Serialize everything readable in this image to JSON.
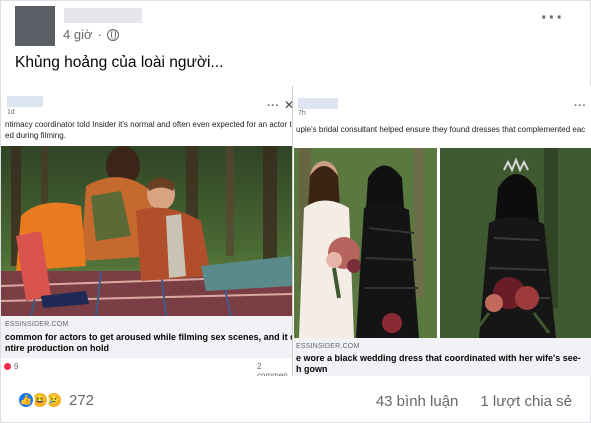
{
  "post": {
    "time": "4 giờ",
    "caption": "Khủng hoảng của loài người..."
  },
  "left_shot": {
    "time": "1d",
    "snippet_lines": [
      "ntimacy coordinator told Insider it's normal and often even expected for an actor to get",
      "ed during filming."
    ],
    "domain": "ESSINSIDER.COM",
    "headline_lines": [
      "common for actors to get aroused while filming sex scenes, and it can put",
      "ntire production on hold"
    ],
    "reaction_count": "9",
    "comments": "2 commen"
  },
  "right_shot": {
    "time": "7h",
    "snippet_lines": [
      "uple's bridal consultant helped ensure they found dresses that complemented eac"
    ],
    "domain": "ESSINSIDER.COM",
    "headline_lines": [
      "e wore a black wedding dress that coordinated with her wife's see-",
      "h gown"
    ]
  },
  "footer": {
    "reaction_count": "272",
    "comments": "43 bình luận",
    "shares": "1 lượt chia sẻ"
  }
}
